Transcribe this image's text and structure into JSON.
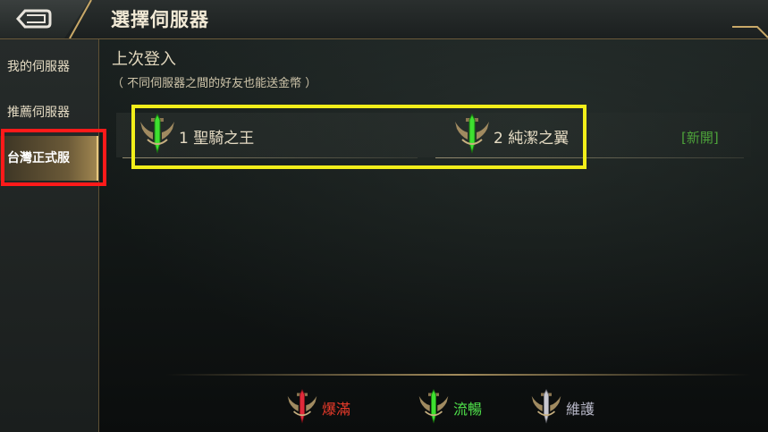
{
  "header": {
    "title": "選擇伺服器",
    "back_icon": "back-arrow-icon"
  },
  "sidebar": {
    "items": [
      {
        "label": "我的伺服器",
        "active": false
      },
      {
        "label": "推薦伺服器",
        "active": false
      },
      {
        "label": "台灣正式服",
        "active": true
      }
    ]
  },
  "main": {
    "section_title": "上次登入",
    "section_note": "（ 不同伺服器之間的好友也能送金幣 ）",
    "servers": [
      {
        "label": "1 聖騎之王",
        "status": "流暢",
        "icon": "server-status-emblem-icon"
      },
      {
        "label": "2 純潔之翼",
        "status": "流暢",
        "icon": "server-status-emblem-icon"
      }
    ],
    "new_tag": "[新開]"
  },
  "legend": [
    {
      "label": "爆滿",
      "color": "#e83a2a"
    },
    {
      "label": "流暢",
      "color": "#4fe04a"
    },
    {
      "label": "維護",
      "color": "#b8b8c8"
    }
  ],
  "colors": {
    "accent_gold": "#c8a868",
    "new_green": "#4da23a",
    "highlight_red": "#ff1a1a",
    "highlight_yellow": "#f2ee1a"
  }
}
